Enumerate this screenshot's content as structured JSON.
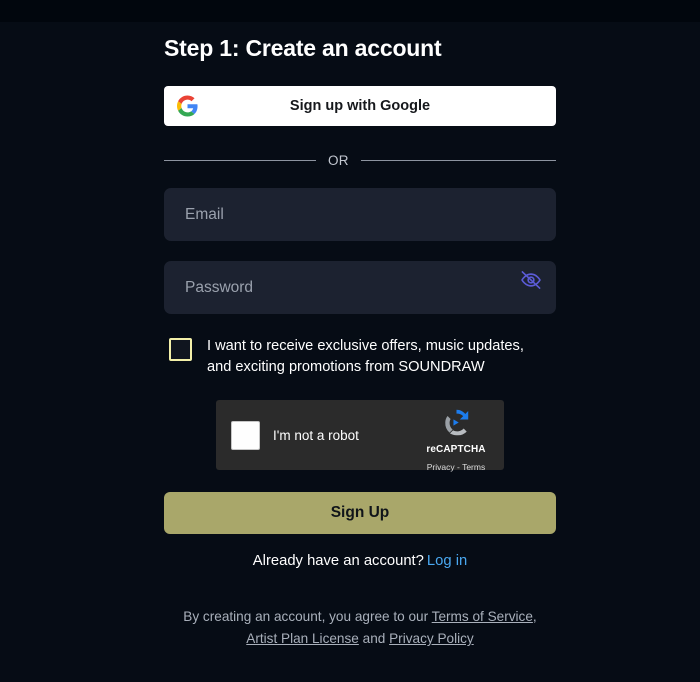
{
  "header": {
    "title": "Step 1: Create an account"
  },
  "google": {
    "label": "Sign up with Google",
    "icon": "google-g-icon"
  },
  "divider": {
    "label": "OR"
  },
  "form": {
    "email": {
      "placeholder": "Email",
      "value": ""
    },
    "password": {
      "placeholder": "Password",
      "value": "",
      "toggle_icon": "eye-off-icon",
      "toggle_color": "#5b5bd6"
    },
    "newsletter": {
      "label": "I want to receive exclusive offers, music updates, and exciting promotions from SOUNDRAW",
      "checked": false,
      "border_color": "#f3f0a9"
    },
    "submit": {
      "label": "Sign Up",
      "color": "#a9a76a"
    }
  },
  "recaptcha": {
    "label": "I'm not a robot",
    "checked": false,
    "brand": "reCAPTCHA",
    "privacy": "Privacy",
    "separator": "-",
    "terms": "Terms",
    "logo_icon": "recaptcha-logo-icon"
  },
  "login": {
    "prompt": "Already have an account?",
    "link": "Log in",
    "link_color": "#4aa8f0"
  },
  "terms": {
    "prefix": "By creating an account, you agree to our",
    "terms_of_service": "Terms of Service",
    "comma": ",",
    "artist_plan_license": "Artist Plan License",
    "and": "and",
    "privacy_policy": "Privacy Policy"
  }
}
